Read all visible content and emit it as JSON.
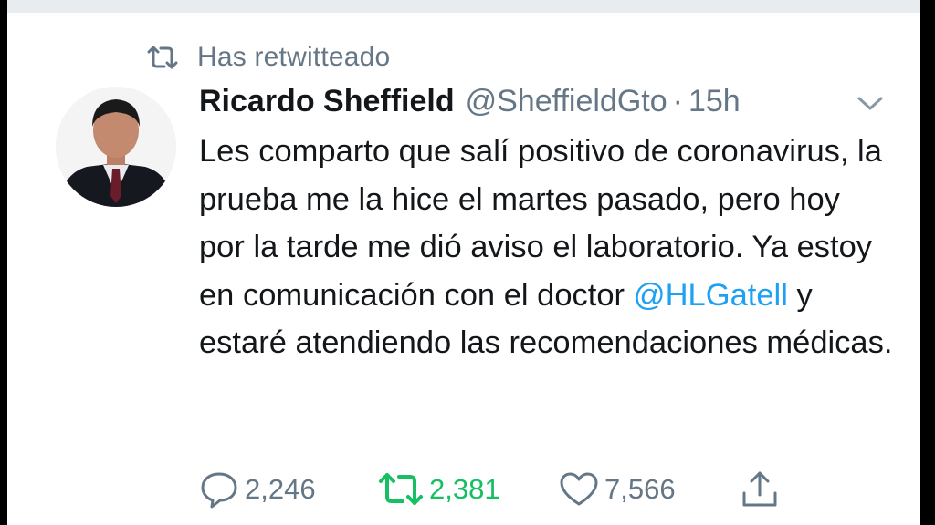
{
  "social_context": {
    "text": "Has retwitteado",
    "icon": "retweet-icon"
  },
  "tweet": {
    "author_name": "Ricardo Sheffield",
    "author_handle": "@SheffieldGto",
    "separator": "·",
    "timestamp": "15h",
    "body_before_mention": "Les comparto que salí positivo de coronavirus, la prueba me la hice el martes pasado, pero hoy por la tarde me dió aviso el laboratorio. Ya estoy en comunicación con el doctor ",
    "mention": "@HLGatell",
    "body_after_mention": " y estaré atendiendo las recomendaciones médicas."
  },
  "actions": {
    "replies": "2,246",
    "retweets": "2,381",
    "likes": "7,566"
  },
  "colors": {
    "text": "#14171a",
    "secondary": "#657786",
    "link": "#1da1f2",
    "retweet_active": "#17bf63",
    "background": "#ffffff"
  }
}
